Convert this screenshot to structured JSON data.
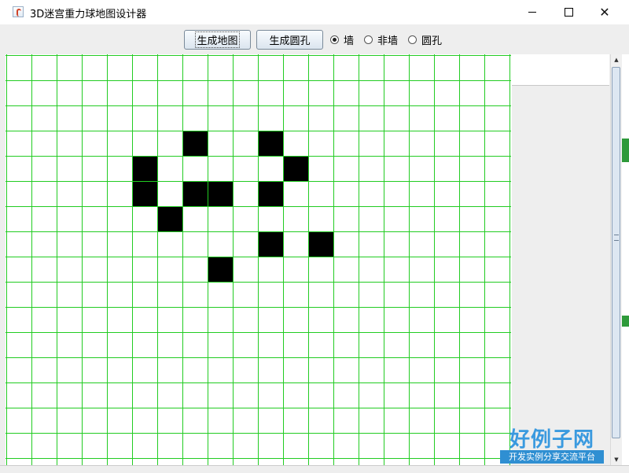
{
  "window": {
    "title": "3D迷宫重力球地图设计器",
    "minimize_glyph": "—",
    "maximize_glyph": "□",
    "close_glyph": "✕"
  },
  "toolbar": {
    "generate_map_label": "生成地图",
    "generate_hole_label": "生成圆孔",
    "radio_options": [
      {
        "label": "墙",
        "selected": true
      },
      {
        "label": "非墙",
        "selected": false
      },
      {
        "label": "圆孔",
        "selected": false
      }
    ]
  },
  "grid": {
    "rows": 16,
    "cols": 20,
    "line_color": "#22cc22",
    "wall_color": "#000000",
    "filled_cells": [
      [
        3,
        7
      ],
      [
        3,
        10
      ],
      [
        4,
        5
      ],
      [
        4,
        11
      ],
      [
        5,
        5
      ],
      [
        5,
        7
      ],
      [
        5,
        8
      ],
      [
        5,
        10
      ],
      [
        6,
        6
      ],
      [
        7,
        10
      ],
      [
        7,
        12
      ],
      [
        8,
        8
      ]
    ]
  },
  "scrollbar": {
    "up_glyph": "▲",
    "down_glyph": "▼"
  },
  "watermark": {
    "title": "好例子网",
    "subtitle": "开发实例分享交流平台"
  }
}
